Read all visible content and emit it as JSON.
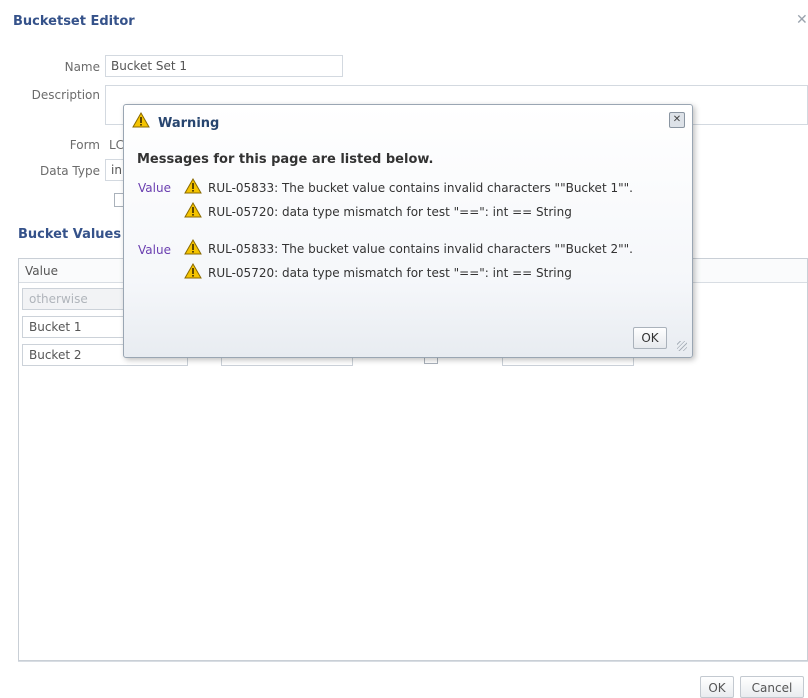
{
  "editor": {
    "title": "Bucketset Editor",
    "name_label": "Name",
    "name_value": "Bucket Set 1",
    "description_label": "Description",
    "form_label": "Form",
    "form_value": "LC",
    "data_type_label": "Data Type",
    "data_type_value": "in",
    "bucket_values_title": "Bucket Values",
    "table": {
      "column_value": "Value",
      "rows": [
        {
          "value": "otherwise",
          "disabled": true
        },
        {
          "value": "Bucket 1",
          "disabled": false
        },
        {
          "value": "Bucket 2",
          "disabled": false
        }
      ]
    },
    "ok_label": "OK",
    "cancel_label": "Cancel"
  },
  "dialog": {
    "title": "Warning",
    "heading": "Messages for this page are listed below.",
    "groups": [
      {
        "label": "Value",
        "messages": [
          "RUL-05833: The bucket value contains invalid characters \"\"Bucket 1\"\".",
          "RUL-05720: data type mismatch for test \"==\": int == String"
        ]
      },
      {
        "label": "Value",
        "messages": [
          "RUL-05833: The bucket value contains invalid characters \"\"Bucket 2\"\".",
          "RUL-05720: data type mismatch for test \"==\": int == String"
        ]
      }
    ],
    "ok_label": "OK"
  },
  "colors": {
    "title_blue": "#35528a",
    "value_label_purple": "#6a3fb0",
    "warning_yellow": "#f5c400"
  }
}
